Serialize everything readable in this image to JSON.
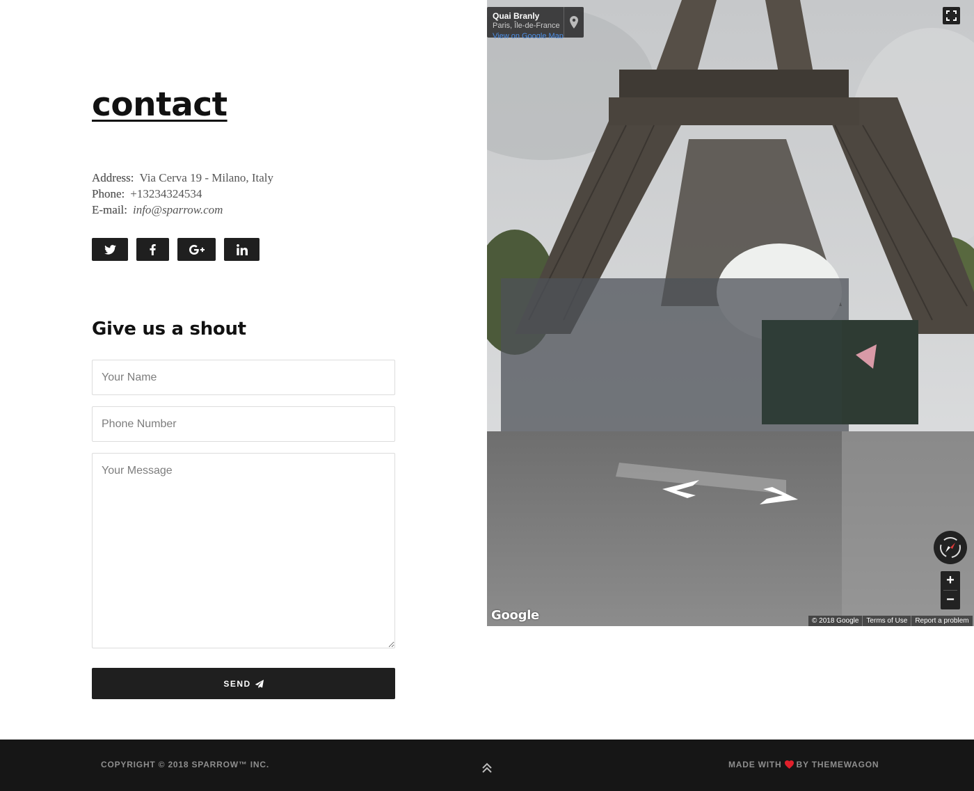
{
  "page": {
    "title": "contact",
    "shout_heading": "Give us a shout"
  },
  "contact_info": {
    "address_label": "Address:",
    "address_value": "Via Cerva 19 - Milano, Italy",
    "phone_label": "Phone:",
    "phone_value": "+13234324534",
    "email_label": "E-mail:",
    "email_value": "info@sparrow.com"
  },
  "social": [
    {
      "name": "twitter",
      "icon": "twitter-icon"
    },
    {
      "name": "facebook",
      "icon": "facebook-icon"
    },
    {
      "name": "google-plus",
      "icon": "google-plus-icon"
    },
    {
      "name": "linkedin",
      "icon": "linkedin-icon"
    }
  ],
  "form": {
    "name_placeholder": "Your Name",
    "phone_placeholder": "Phone Number",
    "message_placeholder": "Your Message",
    "send_label": "SEND",
    "send_icon": "paper-plane-icon"
  },
  "map": {
    "place_name": "Quai Branly",
    "place_region": "Paris, Île-de-France",
    "view_link": "View on Google Maps",
    "logo": "Google",
    "copyright": "© 2018 Google",
    "terms": "Terms of Use",
    "report": "Report a problem",
    "zoom_in": "+",
    "zoom_out": "−"
  },
  "footer": {
    "copyright": "COPYRIGHT © 2018 SPARROW™ INC.",
    "made_prefix": "MADE WITH",
    "made_suffix": "BY THEMEWAGON",
    "heart_color": "#e0202b"
  },
  "colors": {
    "dark": "#1f1f1f",
    "footer_bg": "#161616",
    "footer_text": "#8e8e8e",
    "link_blue": "#4d8fe6"
  }
}
